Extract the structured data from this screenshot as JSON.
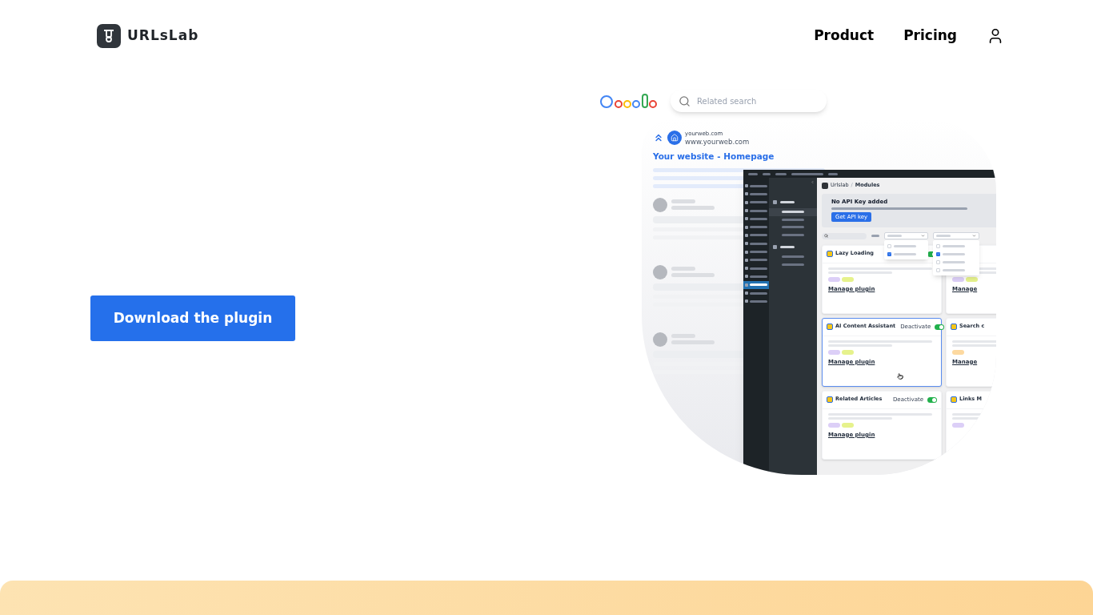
{
  "header": {
    "logo_text": "URLsLab",
    "nav": [
      {
        "label": "Product"
      },
      {
        "label": "Pricing"
      }
    ]
  },
  "hero": {
    "button": "Download the plugin"
  },
  "illustration": {
    "search": {
      "placeholder": "Related search"
    },
    "result": {
      "site": "yourweb.com",
      "url": "www.yourweb.com",
      "title": "Your website - Homepage"
    },
    "admin": {
      "menu": [
        {
          "selected": false
        },
        {
          "selected": false
        },
        {
          "selected": false
        },
        {
          "selected": false
        },
        {
          "selected": false
        },
        {
          "selected": false
        },
        {
          "selected": false
        },
        {
          "selected": false
        },
        {
          "selected": false
        },
        {
          "selected": false
        },
        {
          "selected": false
        },
        {
          "selected": false
        },
        {
          "selected": true
        },
        {
          "selected": false
        },
        {
          "selected": false
        }
      ],
      "submenu": [
        {
          "kind": "heading",
          "selected": false
        },
        {
          "kind": "item",
          "selected": true
        },
        {
          "kind": "item",
          "selected": false
        },
        {
          "kind": "item",
          "selected": false
        },
        {
          "kind": "item",
          "selected": false
        },
        {
          "kind": "heading",
          "selected": false
        },
        {
          "kind": "item",
          "selected": false
        },
        {
          "kind": "item",
          "selected": false
        }
      ],
      "breadcrumb": [
        "Urlslab",
        "/",
        "Modules"
      ],
      "notice": {
        "title": "No API Key added",
        "button": "Get API key"
      },
      "filters": {
        "dropdowns": [
          {
            "options": [
              {
                "checked": false
              },
              {
                "checked": true
              }
            ]
          },
          {
            "options": [
              {
                "checked": false
              },
              {
                "checked": true
              },
              {
                "checked": false
              },
              {
                "checked": false
              }
            ]
          }
        ]
      },
      "cards": [
        {
          "title": "Lazy Loading",
          "active": true,
          "highlighted": false,
          "tags": [
            {
              "color": "#dccff7"
            },
            {
              "color": "#e6f28c"
            }
          ],
          "link": "Manage plugin"
        },
        {
          "tags": [
            {
              "color": "#dccff7"
            },
            {
              "color": "#e6f28c"
            }
          ],
          "link": "Manage"
        },
        {
          "title": "AI Content Assistant",
          "toggle_label": "Deactivate",
          "active": true,
          "highlighted": true,
          "tags": [
            {
              "color": "#dccff7"
            },
            {
              "color": "#e6f28c"
            }
          ],
          "link": "Manage plugin"
        },
        {
          "title": "Search c",
          "tags": [
            {
              "color": "#fdd9a0"
            }
          ],
          "link": "Manage"
        },
        {
          "title": "Related Articles",
          "toggle_label": "Deactivate",
          "active": true,
          "highlighted": false,
          "tags": [
            {
              "color": "#dccff7"
            },
            {
              "color": "#e6f28c"
            }
          ],
          "link": "Manage plugin"
        },
        {
          "title": "Links M",
          "tags": [
            {
              "color": "#dccff7"
            }
          ]
        }
      ]
    }
  }
}
